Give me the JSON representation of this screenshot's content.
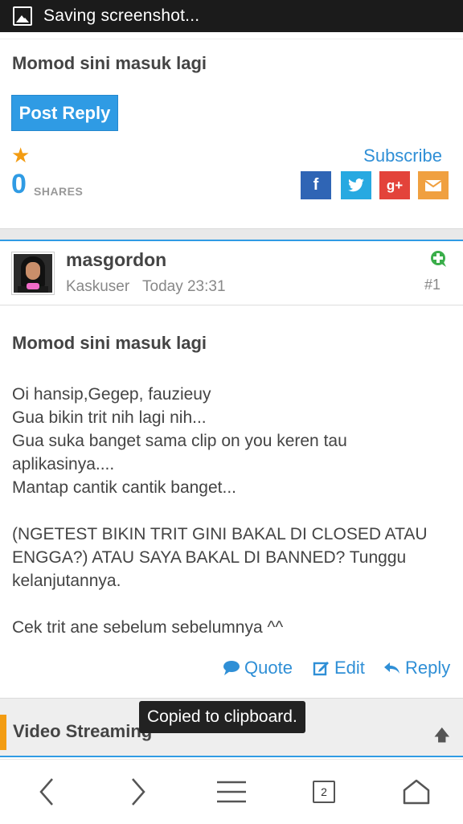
{
  "status_bar": {
    "text": "Saving screenshot..."
  },
  "thread": {
    "title": "Momod sini masuk lagi",
    "post_reply_label": "Post Reply",
    "shares_count": "0",
    "shares_label": "SHARES",
    "subscribe_label": "Subscribe",
    "social_buttons": [
      "facebook",
      "twitter",
      "google-plus",
      "email"
    ]
  },
  "post": {
    "username": "masgordon",
    "rank": "Kaskuser",
    "time": "Today 23:31",
    "number": "#1",
    "title": "Momod sini masuk lagi",
    "body": [
      "Oi hansip,Gegep, fauzieuy\nGua bikin trit nih lagi nih...\nGua suka banget sama clip on you keren tau aplikasinya....\nMantap cantik cantik banget...",
      "(NGETEST BIKIN TRIT GINI BAKAL DI CLOSED ATAU ENGGA?) ATAU SAYA BAKAL DI BANNED? Tunggu kelanjutannya.",
      "Cek trit ane sebelum sebelumnya ^^"
    ],
    "actions": {
      "quote": "Quote",
      "edit": "Edit",
      "reply": "Reply"
    }
  },
  "section": {
    "title": "Video Streaming"
  },
  "toast": {
    "text": "Copied to clipboard."
  },
  "nav": {
    "tab_count": "2"
  },
  "colors": {
    "accent": "#2f9be4",
    "orange": "#f39c12",
    "facebook": "#2f65b5",
    "twitter": "#27a9e1",
    "google": "#e3433a",
    "email": "#f0a040"
  }
}
